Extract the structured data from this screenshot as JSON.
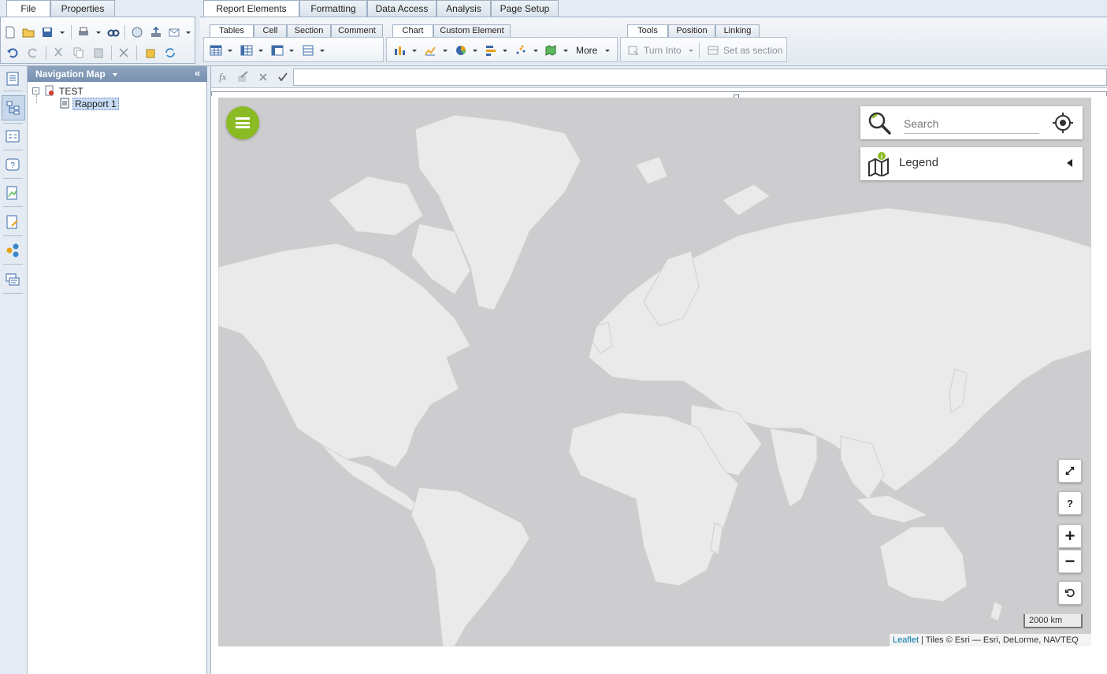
{
  "ribbon": {
    "left_tabs": [
      "File",
      "Properties"
    ],
    "main_tabs": [
      "Report Elements",
      "Formatting",
      "Data Access",
      "Analysis",
      "Page Setup"
    ],
    "sub_tabs_group1": [
      "Tables",
      "Cell",
      "Section",
      "Comment"
    ],
    "sub_tabs_group2": [
      "Chart",
      "Custom Element"
    ],
    "sub_tabs_group3": [
      "Tools",
      "Position",
      "Linking"
    ],
    "more_label": "More",
    "turn_into_label": "Turn Into",
    "set_as_section_label": "Set as section"
  },
  "navigation": {
    "title": "Navigation Map",
    "root": "TEST",
    "child": "Rapport 1"
  },
  "formula": {
    "fx": "fx",
    "value": ""
  },
  "map": {
    "search_placeholder": "Search",
    "legend_label": "Legend",
    "scale_label": "2000 km",
    "attribution_link": "Leaflet",
    "attribution_text": " | Tiles © Esri — Esri, DeLorme, NAVTEQ",
    "fullscreen_icon": "expand-icon",
    "help_label": "?",
    "zoom_in_label": "+",
    "zoom_out_label": "−",
    "reset_icon": "reset-icon"
  },
  "colors": {
    "accent_green": "#8bbb22",
    "ribbon_bg": "#e4ebf3",
    "nav_header": "#7f97b6",
    "map_water": "#cdcdd0",
    "map_land": "#eaeaea",
    "selection": "#c8dcf5"
  }
}
